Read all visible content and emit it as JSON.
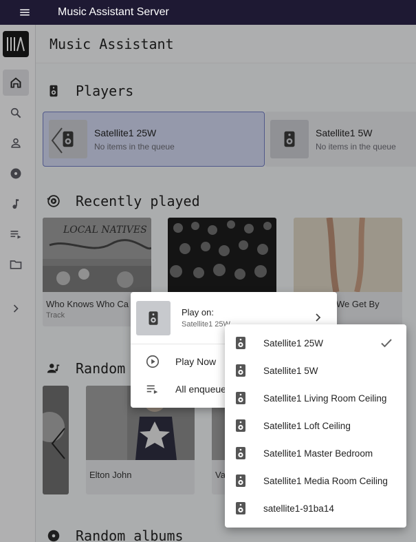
{
  "appbar": {
    "title": "Music Assistant Server",
    "menu_icon": "hamburger-menu-icon"
  },
  "rail": {
    "logo": "music-assistant-logo",
    "items": [
      {
        "icon": "home-icon",
        "active": true
      },
      {
        "icon": "search-icon"
      },
      {
        "icon": "person-icon"
      },
      {
        "icon": "disc-icon"
      },
      {
        "icon": "music-note-icon"
      },
      {
        "icon": "playlist-icon"
      },
      {
        "icon": "folder-icon"
      },
      {
        "icon": "chevron-right-icon"
      }
    ]
  },
  "page": {
    "title": "Music Assistant"
  },
  "players": {
    "title": "Players",
    "cards": [
      {
        "name": "Satellite1 25W",
        "status": "No items in the queue",
        "selected": true
      },
      {
        "name": "Satellite1 5W",
        "status": "No items in the queue",
        "selected": false
      }
    ]
  },
  "recently_played": {
    "title": "Recently played",
    "tiles": [
      {
        "name": "Who Knows Who Ca",
        "sub": "Track"
      },
      {
        "name": "",
        "sub": ""
      },
      {
        "name": "We Get By",
        "sub": ""
      }
    ]
  },
  "random_artists": {
    "title": "Random",
    "tiles": [
      {
        "name": "Elton John"
      },
      {
        "name": "Va"
      }
    ]
  },
  "random_albums": {
    "title": "Random albums"
  },
  "context_menu": {
    "play_on_label": "Play on:",
    "play_on_player": "Satellite1 25W",
    "items": [
      {
        "icon": "play-circle-icon",
        "label": "Play Now"
      },
      {
        "icon": "queue-add-icon",
        "label": "All enqueue"
      }
    ]
  },
  "player_menu": {
    "items": [
      {
        "label": "Satellite1 25W",
        "checked": true
      },
      {
        "label": "Satellite1 5W",
        "checked": false
      },
      {
        "label": "Satellite1 Living Room Ceiling",
        "checked": false
      },
      {
        "label": "Satellite1 Loft Ceiling",
        "checked": false
      },
      {
        "label": "Satellite1 Master Bedroom",
        "checked": false
      },
      {
        "label": "Satellite1 Media Room Ceiling",
        "checked": false
      },
      {
        "label": "satellite1-91ba14",
        "checked": false
      }
    ]
  },
  "colors": {
    "appbar": "#1e1933",
    "selected_card": "#cfd5ee",
    "selected_border": "#3f51b5"
  }
}
